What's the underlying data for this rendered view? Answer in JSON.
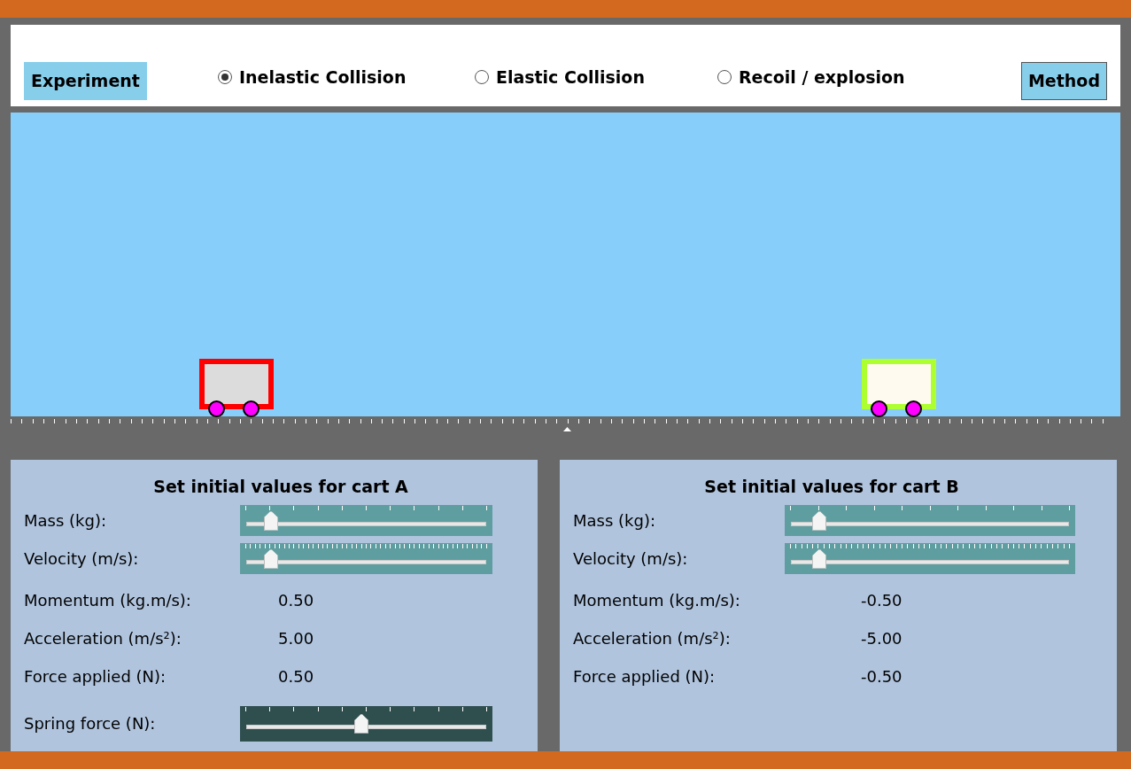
{
  "header": {
    "experiment_button": "Experiment",
    "method_button": "Method",
    "modes": [
      {
        "label": "Inelastic Collision",
        "selected": true
      },
      {
        "label": "Elastic Collision",
        "selected": false
      },
      {
        "label": "Recoil / explosion",
        "selected": false
      }
    ]
  },
  "carts": [
    {
      "color": "#ff0000"
    },
    {
      "color": "#adff2f"
    }
  ],
  "panels": [
    {
      "title": "Set initial values for cart A",
      "rows": [
        {
          "kind": "slider",
          "label": "Mass (kg):",
          "level": 0.1
        },
        {
          "kind": "fine_slider",
          "label": "Velocity (m/s):",
          "level": 0.1
        },
        {
          "kind": "value",
          "label": "Momentum (kg.m/s):",
          "value": "0.50"
        },
        {
          "kind": "value",
          "label": "Acceleration (m/s²):",
          "value": "5.00"
        },
        {
          "kind": "value",
          "label": "Force applied (N):",
          "value": "0.50"
        },
        {
          "kind": "dark_slider",
          "label": "Spring force (N):",
          "level": 0.48
        }
      ]
    },
    {
      "title": "Set initial values for cart B",
      "rows": [
        {
          "kind": "slider",
          "label": "Mass (kg):",
          "level": 0.1
        },
        {
          "kind": "fine_slider",
          "label": "Velocity (m/s):",
          "level": 0.1
        },
        {
          "kind": "value",
          "label": "Momentum (kg.m/s):",
          "value": "-0.50"
        },
        {
          "kind": "value",
          "label": "Acceleration (m/s²):",
          "value": "-5.00"
        },
        {
          "kind": "value",
          "label": "Force applied (N):",
          "value": "-0.50"
        }
      ]
    }
  ]
}
